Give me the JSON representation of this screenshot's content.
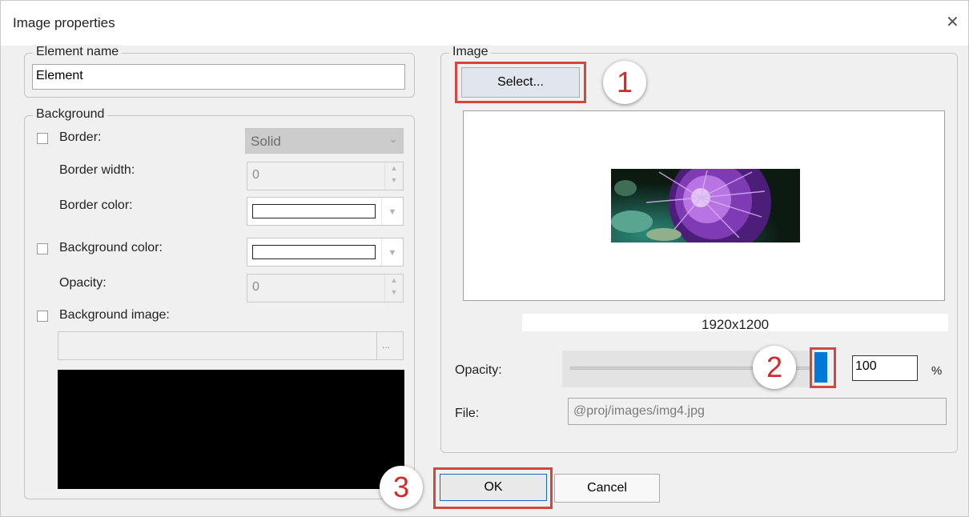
{
  "window": {
    "title": "Image properties",
    "close_glyph": "✕"
  },
  "element_name": {
    "legend": "Element name",
    "value": "Element"
  },
  "background": {
    "legend": "Background",
    "border": {
      "label": "Border:",
      "checked": false,
      "style_value": "Solid",
      "dropdown_icon": "chevron-down-icon"
    },
    "border_width": {
      "label": "Border width:",
      "value": "0"
    },
    "border_color": {
      "label": "Border color:",
      "color": "#ffffff"
    },
    "background_color": {
      "label": "Background color:",
      "checked": false,
      "color": "#ffffff"
    },
    "opacity": {
      "label": "Opacity:",
      "value": "0"
    },
    "background_image": {
      "label": "Background image:",
      "checked": false,
      "path": "",
      "browse_label": "...",
      "preview_color": "#000000"
    }
  },
  "image": {
    "legend": "Image",
    "select_label": "Select...",
    "preview_alt": "purple artichoke flower",
    "dimensions": "1920x1200",
    "opacity_label": "Opacity:",
    "opacity_value": "100",
    "opacity_unit": "%",
    "opacity_level": 1.0,
    "file_label": "File:",
    "file_value": "@proj/images/img4.jpg"
  },
  "buttons": {
    "ok": "OK",
    "cancel": "Cancel"
  },
  "annotations": [
    {
      "number": "1",
      "target": "select-button"
    },
    {
      "number": "2",
      "target": "opacity-slider-thumb"
    },
    {
      "number": "3",
      "target": "ok-button"
    }
  ],
  "accent_colors": {
    "highlight": "#d0483e",
    "badge_text": "#d22a2a",
    "slider_thumb": "#0078d7"
  }
}
